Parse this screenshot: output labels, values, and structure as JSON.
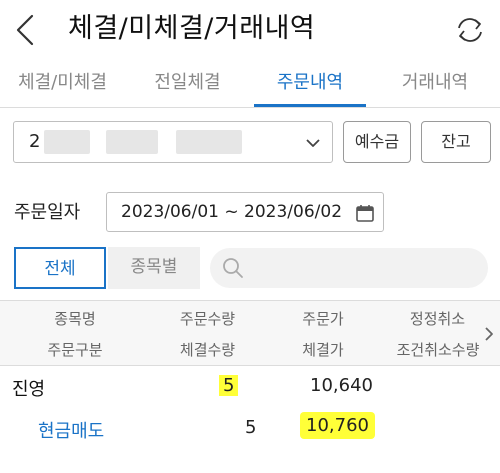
{
  "header": {
    "title": "체결/미체결/거래내역"
  },
  "tabs": [
    {
      "label": "체결/미체결"
    },
    {
      "label": "전일체결"
    },
    {
      "label": "주문내역"
    },
    {
      "label": "거래내역"
    }
  ],
  "active_tab": "주문내역",
  "account": {
    "visible_prefix": "2"
  },
  "buttons": {
    "deposit": "예수금",
    "balance": "잔고"
  },
  "date_filter": {
    "label": "주문일자",
    "range": "2023/06/01 ~ 2023/06/02"
  },
  "segments": {
    "all": "전체",
    "by_stock": "종목별"
  },
  "search": {
    "placeholder": ""
  },
  "table": {
    "header_row1": [
      "종목명",
      "주문수량",
      "주문가",
      "정정취소"
    ],
    "header_row2": [
      "주문구분",
      "체결수량",
      "체결가",
      "조건취소수량"
    ],
    "rows": [
      {
        "name": "진영",
        "order_qty": "5",
        "order_price": "10,640",
        "order_type": "현금매도",
        "filled_qty": "5",
        "filled_price": "10,760"
      }
    ]
  },
  "colors": {
    "accent": "#1a73c7",
    "highlight": "#ffff38"
  }
}
